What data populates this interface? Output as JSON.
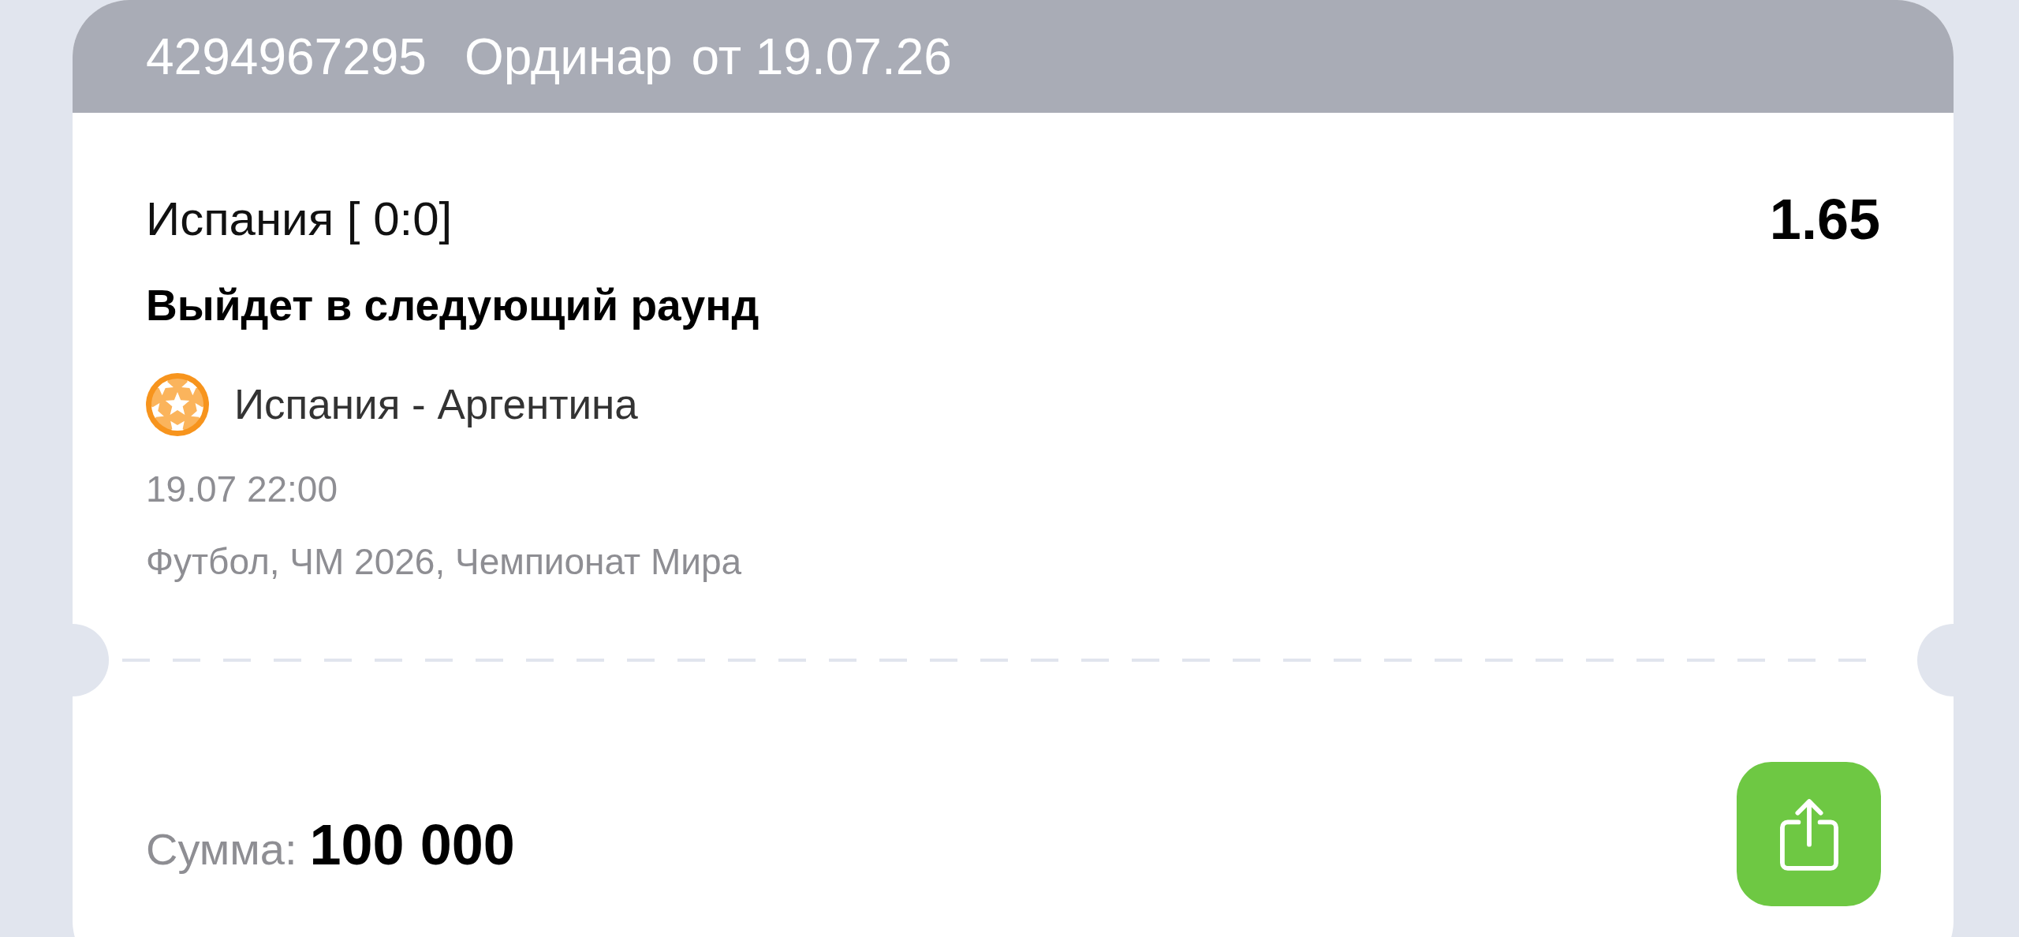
{
  "header": {
    "bet_number": "4294967295",
    "bet_type": "Ординар",
    "bet_date": "от 19.07.26"
  },
  "selection": {
    "outcome": "Испания [ 0:0]",
    "odds": "1.65",
    "market": "Выйдет в следующий раунд"
  },
  "event": {
    "teams": "Испания - Аргентина",
    "start_time": "19.07 22:00",
    "tournament": "Футбол, ЧМ 2026, Чемпионат Мира"
  },
  "footer": {
    "amount_label": "Сумма:",
    "amount": "100 000"
  }
}
